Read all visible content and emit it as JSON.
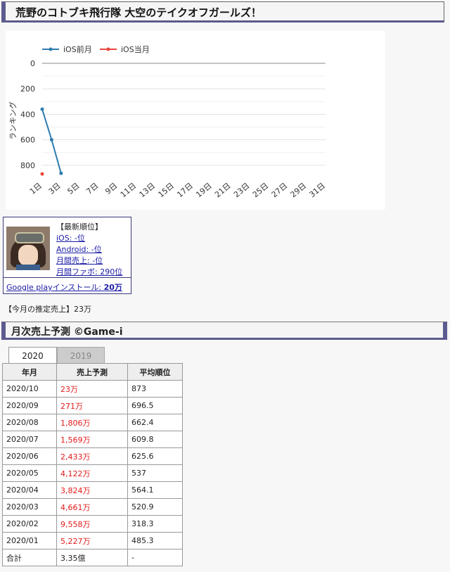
{
  "page_title": "荒野のコトブキ飛行隊 大空のテイクオフガールズ！",
  "chart_data": {
    "type": "line",
    "ylabel": "ランキング",
    "y_reversed": true,
    "ylim": [
      0,
      900
    ],
    "y_ticks": [
      0,
      200,
      400,
      600,
      800
    ],
    "x_ticks": [
      "1日",
      "3日",
      "5日",
      "7日",
      "9日",
      "11日",
      "13日",
      "15日",
      "17日",
      "19日",
      "21日",
      "23日",
      "25日",
      "27日",
      "29日",
      "31日"
    ],
    "x_range": [
      1,
      31
    ],
    "legend_position": "top-left",
    "series": [
      {
        "name": "iOS前月",
        "color": "#2f7db0",
        "points": [
          [
            1,
            360
          ],
          [
            2,
            600
          ],
          [
            3,
            863
          ]
        ]
      },
      {
        "name": "iOS当月",
        "color": "#e8473b",
        "points": [
          [
            1,
            868
          ]
        ]
      }
    ]
  },
  "app_card": {
    "latest_rank_label": "【最新順位】",
    "ios_rank": "iOS: -位",
    "android_rank": "Android: -位",
    "monthly_sales_rank": "月間売上: -位",
    "monthly_fav_rank": "月間ファボ: 290位",
    "gplay_label": "Google playインストール: ",
    "gplay_value": "20万"
  },
  "estimated_sales": "【今月の推定売上】23万",
  "section_title": "月次売上予測 ©Game-i",
  "tabs": [
    "2020",
    "2019"
  ],
  "table": {
    "headers": [
      "年月",
      "売上予測",
      "平均順位"
    ],
    "rows": [
      [
        "2020/10",
        "23万",
        "873"
      ],
      [
        "2020/09",
        "271万",
        "696.5"
      ],
      [
        "2020/08",
        "1,806万",
        "662.4"
      ],
      [
        "2020/07",
        "1,569万",
        "609.8"
      ],
      [
        "2020/06",
        "2,433万",
        "625.6"
      ],
      [
        "2020/05",
        "4,122万",
        "537"
      ],
      [
        "2020/04",
        "3,824万",
        "564.1"
      ],
      [
        "2020/03",
        "4,661万",
        "520.9"
      ],
      [
        "2020/02",
        "9,558万",
        "318.3"
      ],
      [
        "2020/01",
        "5,227万",
        "485.3"
      ]
    ],
    "total": [
      "合計",
      "3.35億",
      "-"
    ]
  }
}
